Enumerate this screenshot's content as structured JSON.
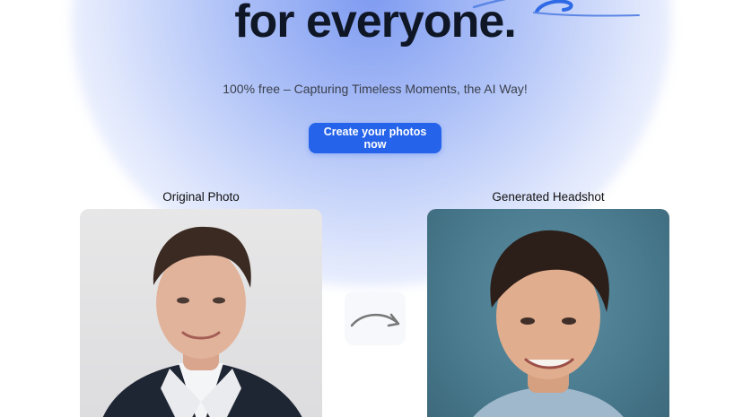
{
  "hero": {
    "title": "for everyone.",
    "subtitle": "100% free – Capturing Timeless Moments, the AI Way!",
    "cta_label": "Create your photos now"
  },
  "comparison": {
    "original_label": "Original Photo",
    "generated_label": "Generated Headshot",
    "arrow_icon": "curved-arrow-right-icon"
  },
  "colors": {
    "accent": "#2563eb",
    "title": "#0f1726",
    "glow": "#7896f0"
  }
}
